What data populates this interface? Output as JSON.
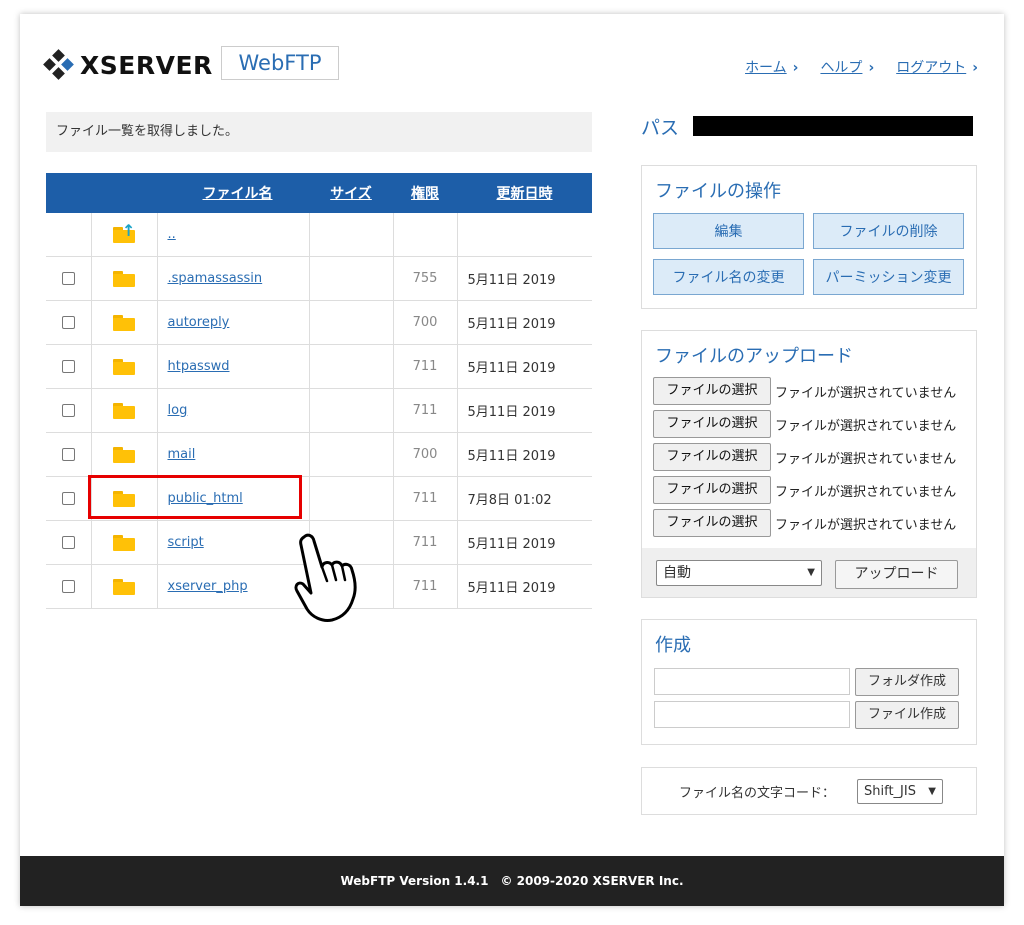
{
  "header": {
    "logo_text": "XSERVER",
    "product_badge": "WebFTP",
    "nav": [
      {
        "label": "ホーム",
        "chevron": "›"
      },
      {
        "label": "ヘルプ",
        "chevron": "›"
      },
      {
        "label": "ログアウト",
        "chevron": "›"
      }
    ]
  },
  "message": "ファイル一覧を取得しました。",
  "table": {
    "headers": {
      "name": "ファイル名",
      "size": "サイズ",
      "perm": "権限",
      "date": "更新日時"
    },
    "parent_link": "..",
    "rows": [
      {
        "name": ".spamassassin",
        "perm": "755",
        "date": "5月11日 2019"
      },
      {
        "name": "autoreply",
        "perm": "700",
        "date": "5月11日 2019"
      },
      {
        "name": "htpasswd",
        "perm": "711",
        "date": "5月11日 2019"
      },
      {
        "name": "log",
        "perm": "711",
        "date": "5月11日 2019"
      },
      {
        "name": "mail",
        "perm": "700",
        "date": "5月11日 2019"
      },
      {
        "name": "public_html",
        "perm": "711",
        "date": "7月8日 01:02"
      },
      {
        "name": "script",
        "perm": "711",
        "date": "5月11日 2019"
      },
      {
        "name": "xserver_php",
        "perm": "711",
        "date": "5月11日 2019"
      }
    ]
  },
  "path": {
    "label": "パス"
  },
  "file_ops": {
    "title": "ファイルの操作",
    "edit": "編集",
    "delete": "ファイルの削除",
    "rename": "ファイル名の変更",
    "chmod": "パーミッション変更"
  },
  "upload": {
    "title": "ファイルのアップロード",
    "choose_label": "ファイルの選択",
    "no_file": "ファイルが選択されていません",
    "encoding_selected": "自動",
    "upload_button": "アップロード"
  },
  "create": {
    "title": "作成",
    "folder_button": "フォルダ作成",
    "file_button": "ファイル作成"
  },
  "filename_code": {
    "label": "ファイル名の文字コード：",
    "selected": "Shift_JIS"
  },
  "footer": "WebFTP Version 1.4.1　© 2009-2020 XSERVER Inc.",
  "icons": {
    "logo": "xserver-diamond-logo-icon",
    "parent": "parent-folder-icon",
    "folder": "folder-icon",
    "pointer": "pointing-hand-icon"
  },
  "colors": {
    "accent": "#2a6db3",
    "table_header": "#1d5ea8",
    "folder": "#ffc107",
    "highlight": "#e60000",
    "footer_bg": "#222222"
  }
}
